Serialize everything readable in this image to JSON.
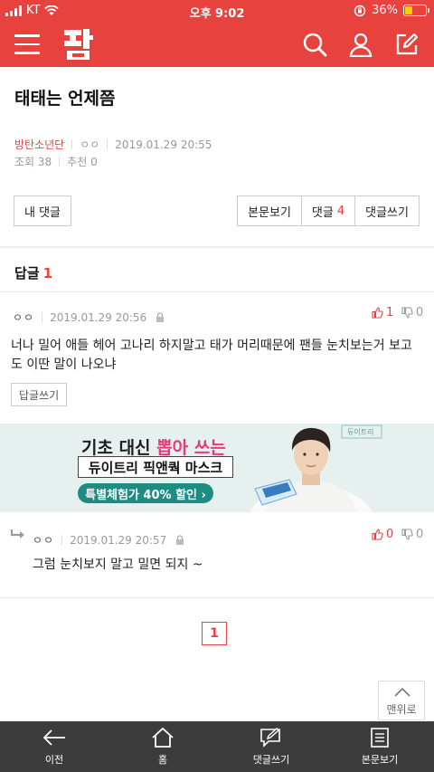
{
  "status_bar": {
    "carrier": "KT",
    "time": "오후 9:02",
    "battery": "36%",
    "battery_level": 0.36
  },
  "header": {
    "logo": "판",
    "icons": [
      "menu-icon",
      "search-icon",
      "user-icon",
      "write-icon"
    ]
  },
  "post": {
    "title": "태태는 언제쯤",
    "board": "방탄소년단",
    "author": "ㅇㅇ",
    "datetime": "2019.01.29 20:55",
    "views_label": "조회 38",
    "likes_label": "추천 0"
  },
  "actions": {
    "my_comments": "내 댓글",
    "view_post": "본문보기",
    "comments_label": "댓글",
    "comments_count": "4",
    "write_comment": "댓글쓰기"
  },
  "replies": {
    "heading": "답글",
    "count": "1"
  },
  "comment": {
    "author": "ㅇㅇ",
    "datetime": "2019.01.29 20:56",
    "up": "1",
    "down": "0",
    "text": "너나 밀어 애들 헤어 고나리 하지말고 태가 머리때문에 팬들 눈치보는거 보고도 이딴 말이 나오냐",
    "reply_button": "답글쓰기"
  },
  "ad": {
    "line1_a": "기초 대신 ",
    "line1_b": "뽑아 쓰는",
    "line2": "듀이트리 픽앤쿽 마스크",
    "line3": "특별체험가 40% 할인 ›",
    "brand": "듀이트리"
  },
  "reply": {
    "author": "ㅇㅇ",
    "datetime": "2019.01.29 20:57",
    "up": "0",
    "down": "0",
    "text": "그럼 눈치보지 말고 밀면 되지 ~"
  },
  "pagination": {
    "current": "1"
  },
  "to_top": "맨위로",
  "bottom_nav": {
    "back": "이전",
    "home": "홈",
    "write": "댓글쓰기",
    "view": "본문보기"
  },
  "colors": {
    "brand": "#e8423f",
    "bottom_bar": "#3c3c3c",
    "ad_bg": "#e6f1ef",
    "ad_pink": "#e8397a",
    "ad_teal": "#1f8c84"
  }
}
